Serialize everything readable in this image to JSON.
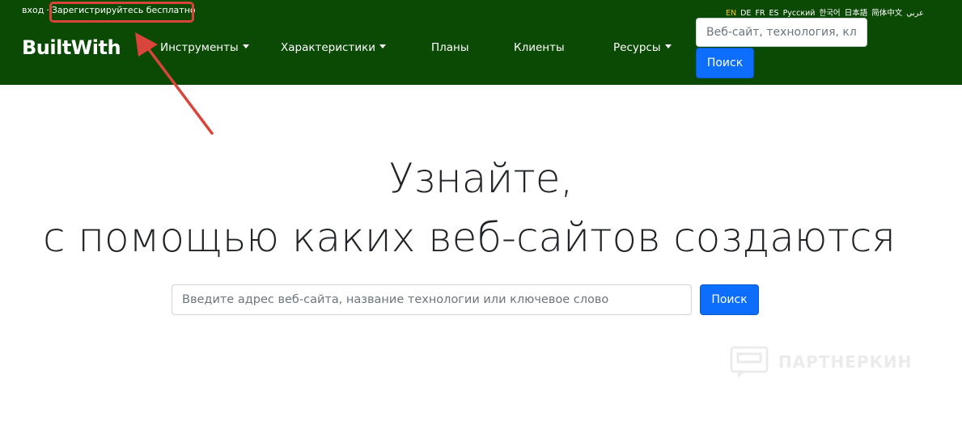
{
  "auth": {
    "login": "вход",
    "separator": "·",
    "register": "Зарегистрируйтесь бесплатно"
  },
  "languages": [
    "EN",
    "DE",
    "FR",
    "ES",
    "Русский",
    "한국어",
    "日本語",
    "简体中文",
    "عربي"
  ],
  "active_language": "EN",
  "logo": "BuiltWith",
  "nav": {
    "tools": "Инструменты",
    "features": "Характеристики",
    "plans": "Планы",
    "customers": "Клиенты",
    "resources": "Ресурсы"
  },
  "top_search": {
    "placeholder": "Веб-сайт, технология, ключевое слово",
    "button": "Поиск"
  },
  "hero": {
    "line1": "Узнайте,",
    "line2": "с помощью каких веб-сайтов создаются"
  },
  "main_search": {
    "placeholder": "Введите адрес веб-сайта, название технологии или ключевое слово",
    "button": "Поиск"
  },
  "watermark": "ПАРТНЕРКИН",
  "colors": {
    "header_bg": "#0a4a05",
    "primary": "#0d6efd",
    "annotation": "#d9453a",
    "active_language": "#f2c230"
  }
}
